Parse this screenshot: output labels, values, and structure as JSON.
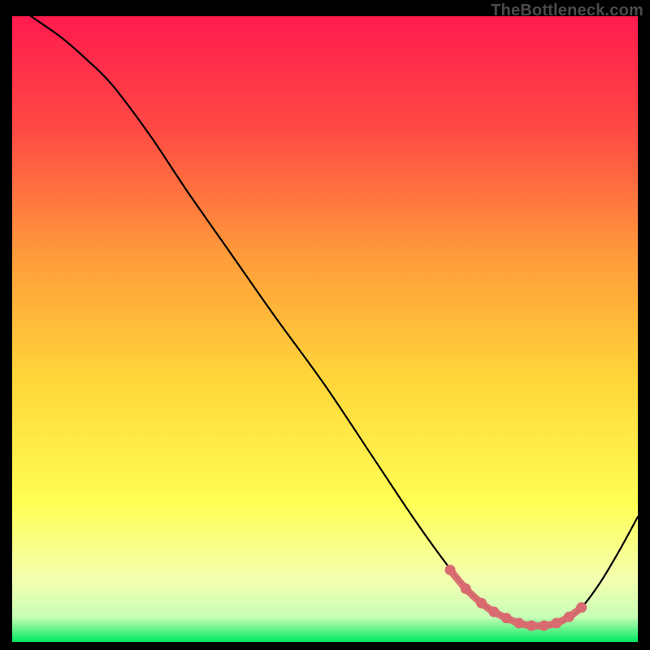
{
  "watermark": "TheBottleneck.com",
  "chart_data": {
    "type": "line",
    "title": "",
    "xlabel": "",
    "ylabel": "",
    "xlim": [
      0,
      100
    ],
    "ylim": [
      0,
      100
    ],
    "grid": false,
    "legend": false,
    "background_gradient": {
      "top_color": "#ff1a4e",
      "mid_colors": [
        "#ff7a3a",
        "#ffd63a",
        "#ffff66"
      ],
      "bottom_color": "#00e860"
    },
    "series": [
      {
        "name": "curve",
        "stroke": "#000000",
        "x": [
          3,
          8,
          12,
          16,
          22,
          28,
          35,
          42,
          50,
          58,
          64,
          69,
          73,
          76,
          79,
          82,
          85,
          88,
          91,
          94,
          97,
          100
        ],
        "y": [
          100,
          96.5,
          93,
          89,
          81,
          72,
          62,
          52,
          41,
          29,
          20,
          13,
          8,
          5.5,
          3.8,
          2.8,
          2.5,
          3.2,
          5.5,
          9.5,
          14.5,
          20
        ]
      },
      {
        "name": "valley-markers",
        "stroke": "#d96a6f",
        "marker": "circle",
        "x": [
          70,
          72.5,
          75,
          77,
          79,
          81,
          83,
          85,
          87,
          89,
          91
        ],
        "y": [
          11.5,
          8.5,
          6.2,
          4.8,
          3.8,
          3.0,
          2.6,
          2.6,
          3.0,
          4.0,
          5.5
        ]
      }
    ]
  }
}
